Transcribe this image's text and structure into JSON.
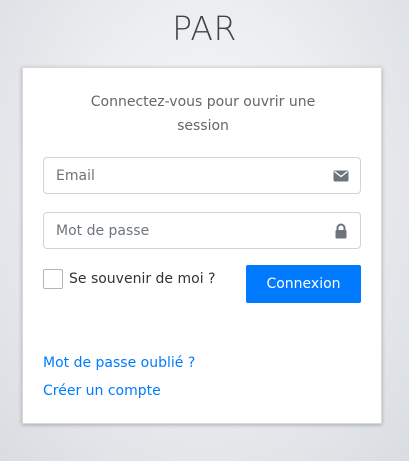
{
  "logo": {
    "text": "PAR"
  },
  "login": {
    "message": "Connectez-vous pour ouvrir une session",
    "email": {
      "placeholder": "Email",
      "value": "",
      "icon": "envelope-icon"
    },
    "password": {
      "placeholder": "Mot de passe",
      "value": "",
      "icon": "lock-icon"
    },
    "remember": {
      "label": "Se souvenir de moi ?",
      "checked": false
    },
    "submit_label": "Connexion",
    "links": {
      "forgot_password": "Mot de passe oublié ?",
      "register": "Créer un compte"
    }
  },
  "colors": {
    "primary": "#007bff",
    "icon": "#6c757d"
  }
}
